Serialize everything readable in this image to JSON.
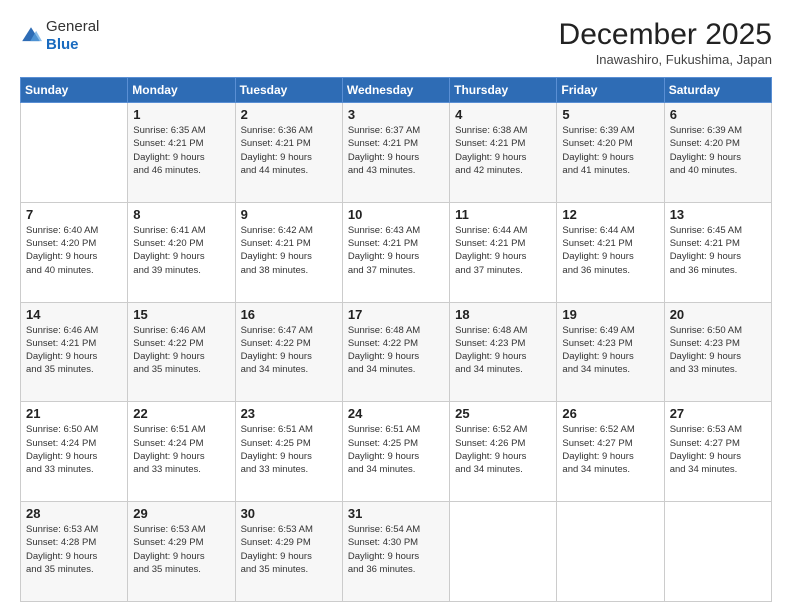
{
  "logo": {
    "general": "General",
    "blue": "Blue"
  },
  "header": {
    "title": "December 2025",
    "subtitle": "Inawashiro, Fukushima, Japan"
  },
  "weekdays": [
    "Sunday",
    "Monday",
    "Tuesday",
    "Wednesday",
    "Thursday",
    "Friday",
    "Saturday"
  ],
  "weeks": [
    [
      {
        "day": "",
        "sunrise": "",
        "sunset": "",
        "daylight": ""
      },
      {
        "day": "1",
        "sunrise": "Sunrise: 6:35 AM",
        "sunset": "Sunset: 4:21 PM",
        "daylight": "Daylight: 9 hours and 46 minutes."
      },
      {
        "day": "2",
        "sunrise": "Sunrise: 6:36 AM",
        "sunset": "Sunset: 4:21 PM",
        "daylight": "Daylight: 9 hours and 44 minutes."
      },
      {
        "day": "3",
        "sunrise": "Sunrise: 6:37 AM",
        "sunset": "Sunset: 4:21 PM",
        "daylight": "Daylight: 9 hours and 43 minutes."
      },
      {
        "day": "4",
        "sunrise": "Sunrise: 6:38 AM",
        "sunset": "Sunset: 4:21 PM",
        "daylight": "Daylight: 9 hours and 42 minutes."
      },
      {
        "day": "5",
        "sunrise": "Sunrise: 6:39 AM",
        "sunset": "Sunset: 4:20 PM",
        "daylight": "Daylight: 9 hours and 41 minutes."
      },
      {
        "day": "6",
        "sunrise": "Sunrise: 6:39 AM",
        "sunset": "Sunset: 4:20 PM",
        "daylight": "Daylight: 9 hours and 40 minutes."
      }
    ],
    [
      {
        "day": "7",
        "sunrise": "Sunrise: 6:40 AM",
        "sunset": "Sunset: 4:20 PM",
        "daylight": "Daylight: 9 hours and 40 minutes."
      },
      {
        "day": "8",
        "sunrise": "Sunrise: 6:41 AM",
        "sunset": "Sunset: 4:20 PM",
        "daylight": "Daylight: 9 hours and 39 minutes."
      },
      {
        "day": "9",
        "sunrise": "Sunrise: 6:42 AM",
        "sunset": "Sunset: 4:21 PM",
        "daylight": "Daylight: 9 hours and 38 minutes."
      },
      {
        "day": "10",
        "sunrise": "Sunrise: 6:43 AM",
        "sunset": "Sunset: 4:21 PM",
        "daylight": "Daylight: 9 hours and 37 minutes."
      },
      {
        "day": "11",
        "sunrise": "Sunrise: 6:44 AM",
        "sunset": "Sunset: 4:21 PM",
        "daylight": "Daylight: 9 hours and 37 minutes."
      },
      {
        "day": "12",
        "sunrise": "Sunrise: 6:44 AM",
        "sunset": "Sunset: 4:21 PM",
        "daylight": "Daylight: 9 hours and 36 minutes."
      },
      {
        "day": "13",
        "sunrise": "Sunrise: 6:45 AM",
        "sunset": "Sunset: 4:21 PM",
        "daylight": "Daylight: 9 hours and 36 minutes."
      }
    ],
    [
      {
        "day": "14",
        "sunrise": "Sunrise: 6:46 AM",
        "sunset": "Sunset: 4:21 PM",
        "daylight": "Daylight: 9 hours and 35 minutes."
      },
      {
        "day": "15",
        "sunrise": "Sunrise: 6:46 AM",
        "sunset": "Sunset: 4:22 PM",
        "daylight": "Daylight: 9 hours and 35 minutes."
      },
      {
        "day": "16",
        "sunrise": "Sunrise: 6:47 AM",
        "sunset": "Sunset: 4:22 PM",
        "daylight": "Daylight: 9 hours and 34 minutes."
      },
      {
        "day": "17",
        "sunrise": "Sunrise: 6:48 AM",
        "sunset": "Sunset: 4:22 PM",
        "daylight": "Daylight: 9 hours and 34 minutes."
      },
      {
        "day": "18",
        "sunrise": "Sunrise: 6:48 AM",
        "sunset": "Sunset: 4:23 PM",
        "daylight": "Daylight: 9 hours and 34 minutes."
      },
      {
        "day": "19",
        "sunrise": "Sunrise: 6:49 AM",
        "sunset": "Sunset: 4:23 PM",
        "daylight": "Daylight: 9 hours and 34 minutes."
      },
      {
        "day": "20",
        "sunrise": "Sunrise: 6:50 AM",
        "sunset": "Sunset: 4:23 PM",
        "daylight": "Daylight: 9 hours and 33 minutes."
      }
    ],
    [
      {
        "day": "21",
        "sunrise": "Sunrise: 6:50 AM",
        "sunset": "Sunset: 4:24 PM",
        "daylight": "Daylight: 9 hours and 33 minutes."
      },
      {
        "day": "22",
        "sunrise": "Sunrise: 6:51 AM",
        "sunset": "Sunset: 4:24 PM",
        "daylight": "Daylight: 9 hours and 33 minutes."
      },
      {
        "day": "23",
        "sunrise": "Sunrise: 6:51 AM",
        "sunset": "Sunset: 4:25 PM",
        "daylight": "Daylight: 9 hours and 33 minutes."
      },
      {
        "day": "24",
        "sunrise": "Sunrise: 6:51 AM",
        "sunset": "Sunset: 4:25 PM",
        "daylight": "Daylight: 9 hours and 34 minutes."
      },
      {
        "day": "25",
        "sunrise": "Sunrise: 6:52 AM",
        "sunset": "Sunset: 4:26 PM",
        "daylight": "Daylight: 9 hours and 34 minutes."
      },
      {
        "day": "26",
        "sunrise": "Sunrise: 6:52 AM",
        "sunset": "Sunset: 4:27 PM",
        "daylight": "Daylight: 9 hours and 34 minutes."
      },
      {
        "day": "27",
        "sunrise": "Sunrise: 6:53 AM",
        "sunset": "Sunset: 4:27 PM",
        "daylight": "Daylight: 9 hours and 34 minutes."
      }
    ],
    [
      {
        "day": "28",
        "sunrise": "Sunrise: 6:53 AM",
        "sunset": "Sunset: 4:28 PM",
        "daylight": "Daylight: 9 hours and 35 minutes."
      },
      {
        "day": "29",
        "sunrise": "Sunrise: 6:53 AM",
        "sunset": "Sunset: 4:29 PM",
        "daylight": "Daylight: 9 hours and 35 minutes."
      },
      {
        "day": "30",
        "sunrise": "Sunrise: 6:53 AM",
        "sunset": "Sunset: 4:29 PM",
        "daylight": "Daylight: 9 hours and 35 minutes."
      },
      {
        "day": "31",
        "sunrise": "Sunrise: 6:54 AM",
        "sunset": "Sunset: 4:30 PM",
        "daylight": "Daylight: 9 hours and 36 minutes."
      },
      {
        "day": "",
        "sunrise": "",
        "sunset": "",
        "daylight": ""
      },
      {
        "day": "",
        "sunrise": "",
        "sunset": "",
        "daylight": ""
      },
      {
        "day": "",
        "sunrise": "",
        "sunset": "",
        "daylight": ""
      }
    ]
  ]
}
